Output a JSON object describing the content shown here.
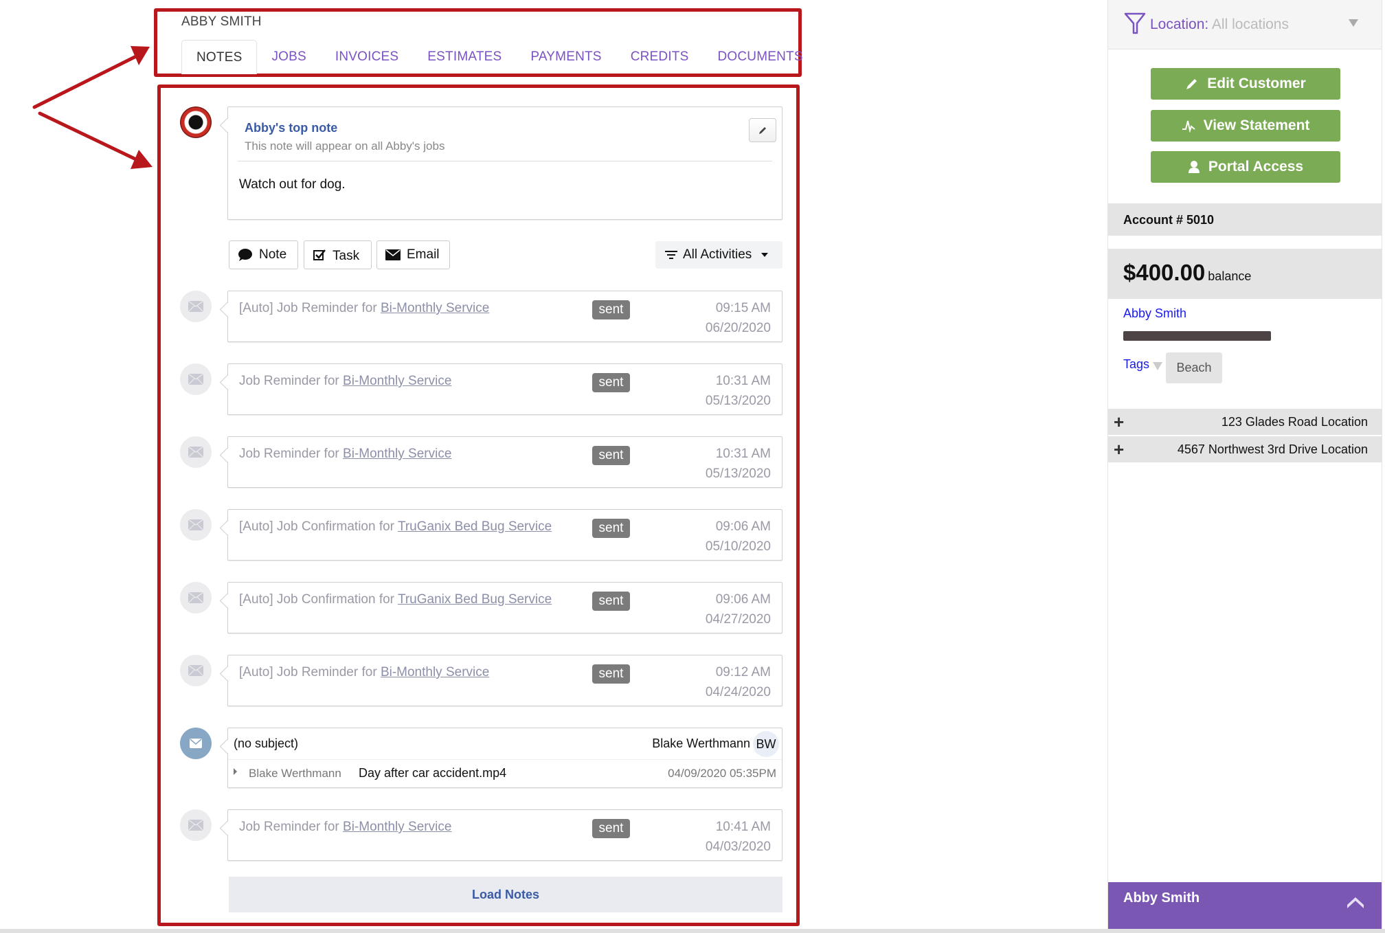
{
  "header": {
    "customer_name": "ABBY SMITH",
    "tabs": [
      {
        "label": "NOTES",
        "active": true
      },
      {
        "label": "JOBS"
      },
      {
        "label": "INVOICES"
      },
      {
        "label": "ESTIMATES"
      },
      {
        "label": "PAYMENTS"
      },
      {
        "label": "CREDITS"
      },
      {
        "label": "DOCUMENTS"
      }
    ]
  },
  "top_note": {
    "title": "Abby's top note",
    "subtitle": "This note will appear on all Abby's jobs",
    "body": "Watch out for dog.",
    "icon": "pencil-icon"
  },
  "actions": {
    "note_label": "Note",
    "task_label": "Task",
    "email_label": "Email",
    "filter_label": "All Activities"
  },
  "messages": [
    {
      "prefix": "[Auto] Job Reminder for ",
      "link": "Bi-Monthly Service",
      "status": "sent",
      "time": "09:15 AM",
      "date": "06/20/2020"
    },
    {
      "prefix": "Job Reminder for ",
      "link": "Bi-Monthly Service",
      "status": "sent",
      "time": "10:31 AM",
      "date": "05/13/2020"
    },
    {
      "prefix": "Job Reminder for ",
      "link": "Bi-Monthly Service",
      "status": "sent",
      "time": "10:31 AM",
      "date": "05/13/2020"
    },
    {
      "prefix": "[Auto] Job Confirmation for ",
      "link": "TruGanix Bed Bug Service",
      "status": "sent",
      "time": "09:06 AM",
      "date": "05/10/2020"
    },
    {
      "prefix": "[Auto] Job Confirmation for ",
      "link": "TruGanix Bed Bug Service",
      "status": "sent",
      "time": "09:06 AM",
      "date": "04/27/2020"
    },
    {
      "prefix": "[Auto] Job Reminder for ",
      "link": "Bi-Monthly Service",
      "status": "sent",
      "time": "09:12 AM",
      "date": "04/24/2020"
    },
    {
      "prefix": "Job Reminder for ",
      "link": "Bi-Monthly Service",
      "status": "sent",
      "time": "10:41 AM",
      "date": "04/03/2020"
    }
  ],
  "email_thread": {
    "subject": "(no subject)",
    "from": "Blake Werthmann",
    "initials": "BW",
    "sender": "Blake Werthmann",
    "attachment": "Day after car accident.mp4",
    "datetime": "04/09/2020 05:35PM"
  },
  "load_notes_label": "Load Notes",
  "sidebar": {
    "location_label": "Location:",
    "location_value": "All locations",
    "buttons": {
      "edit_customer": "Edit Customer",
      "view_statement": "View Statement",
      "portal_access": "Portal Access"
    },
    "account": "Account # 5010",
    "balance_amount": "$400.00",
    "balance_label": "balance",
    "customer_link": "Abby Smith",
    "tags_label": "Tags",
    "tags": [
      "Beach"
    ],
    "locations": [
      "123 Glades Road Location",
      "4567 Northwest 3rd Drive Location"
    ],
    "chat_name": "Abby Smith"
  },
  "colors": {
    "accent_purple": "#7b57b4",
    "tab_purple": "#7a52c1",
    "button_green": "#7cab55",
    "annotation_red": "#b8171b",
    "link_blue": "#3a5aa6"
  }
}
